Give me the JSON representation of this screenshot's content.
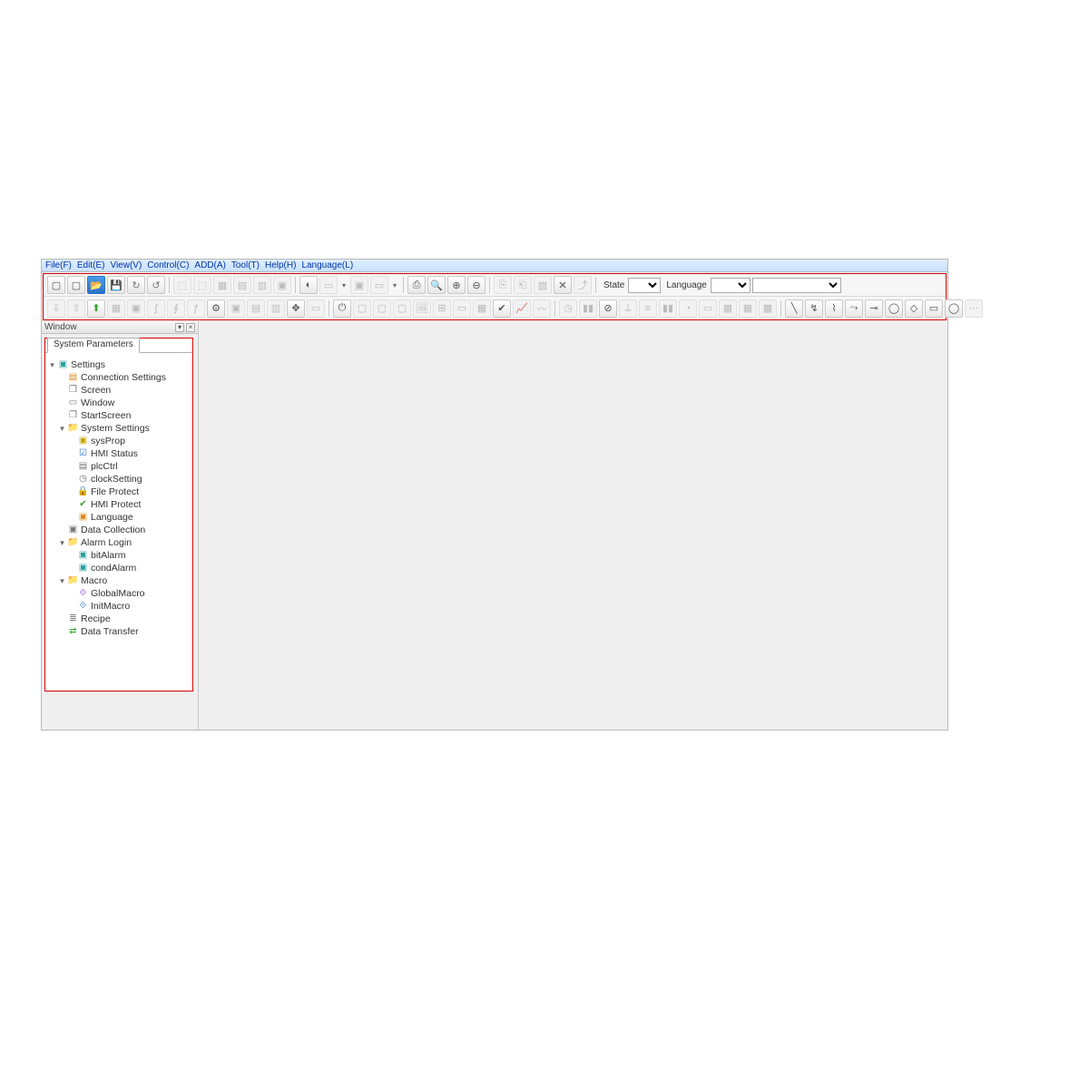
{
  "menu": {
    "file": "File(F)",
    "edit": "Edit(E)",
    "view": "View(V)",
    "control": "Control(C)",
    "add": "ADD(A)",
    "tool": "Tool(T)",
    "help": "Help(H)",
    "language": "Language(L)"
  },
  "toolbar_labels": {
    "state": "State",
    "language": "Language"
  },
  "window_panel": {
    "title": "Window",
    "tab": "System Parameters"
  },
  "tree": {
    "settings": "Settings",
    "connection": "Connection Settings",
    "screen": "Screen",
    "window": "Window",
    "startscreen": "StartScreen",
    "system_settings": "System Settings",
    "sysprop": "sysProp",
    "hmi_status": "HMI Status",
    "plcctrl": "plcCtrl",
    "clocksetting": "clockSetting",
    "file_protect": "File Protect",
    "hmi_protect": "HMI Protect",
    "language_item": "Language",
    "data_collection": "Data Collection",
    "alarm_login": "Alarm Login",
    "bitalarm": "bitAlarm",
    "condalarm": "condAlarm",
    "macro": "Macro",
    "globalmacro": "GlobalMacro",
    "initmacro": "InitMacro",
    "recipe": "Recipe",
    "data_transfer": "Data Transfer"
  }
}
